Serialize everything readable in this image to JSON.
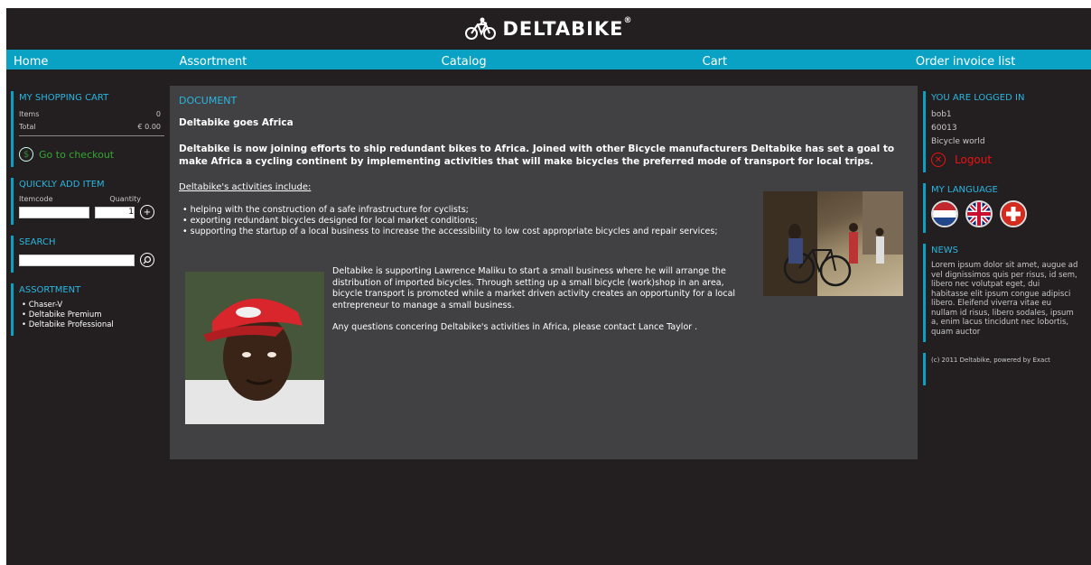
{
  "brand": {
    "name": "DELTABIKE",
    "reg": "®"
  },
  "nav": [
    "Home",
    "Assortment",
    "Catalog",
    "Cart",
    "Order invoice list"
  ],
  "cart": {
    "title": "MY SHOPPING CART",
    "items_label": "Items",
    "items_value": "0",
    "total_label": "Total",
    "total_value": "€ 0.00",
    "checkout_label": "Go to checkout"
  },
  "quick_add": {
    "title": "QUICKLY ADD ITEM",
    "itemcode_label": "Itemcode",
    "quantity_label": "Quantity",
    "quantity_value": "1"
  },
  "search": {
    "title": "SEARCH"
  },
  "assortment": {
    "title": "ASSORTMENT",
    "items": [
      "Chaser-V",
      "Deltabike Premium",
      "Deltabike Professional"
    ]
  },
  "document": {
    "title": "DOCUMENT",
    "heading": "Deltabike goes Africa",
    "intro": "Deltabike is now joining efforts to ship redundant bikes to Africa. Joined with other Bicycle manufacturers Deltabike has set a goal to make Africa a cycling continent by implementing activities that will make bicycles the preferred mode of transport for local trips.",
    "activities_title": "Deltabike's activities include:",
    "activities": [
      "helping with the construction of a safe infrastructure for cyclists;",
      "exporting redundant bicycles designed for local market conditions;",
      "supporting the startup of a local business to increase the accessibility to low cost appropriate bicycles and repair services;"
    ],
    "paragraph1": "Deltabike is supporting Lawrence Maliku to start a small business where he will arrange the distribution of imported bicycles. Through setting up a small bicycle (work)shop in an area, bicycle transport is promoted while a market driven activity creates an opportunity for a local entrepreneur to manage a small business.",
    "paragraph2": "Any questions concering Deltabike's activities in Africa, please contact Lance Taylor ."
  },
  "user": {
    "title": "YOU ARE LOGGED IN",
    "name": "bob1",
    "code": "60013",
    "company": "Bicycle world",
    "logout_label": "Logout"
  },
  "language": {
    "title": "MY LANGUAGE",
    "flags": [
      "netherlands-flag-icon",
      "uk-flag-icon",
      "swiss-flag-icon"
    ]
  },
  "news": {
    "title": "NEWS",
    "text": "Lorem ipsum dolor sit amet, augue ad vel dignissimos quis per risus, id sem, libero nec volutpat eget, dui habitasse elit ipsum congue adipisci libero. Eleifend viverra vitae eu nullam id risus, libero sodales, ipsum a, enim lacus tincidunt nec lobortis, quam auctor"
  },
  "footer": "(c) 2011 Deltabike, powered by Exact",
  "colors": {
    "accent": "#0aa2c4",
    "background": "#231f20",
    "content": "#414042",
    "title": "#29b6e0",
    "checkout": "#33a833",
    "logout": "#ee1111"
  }
}
